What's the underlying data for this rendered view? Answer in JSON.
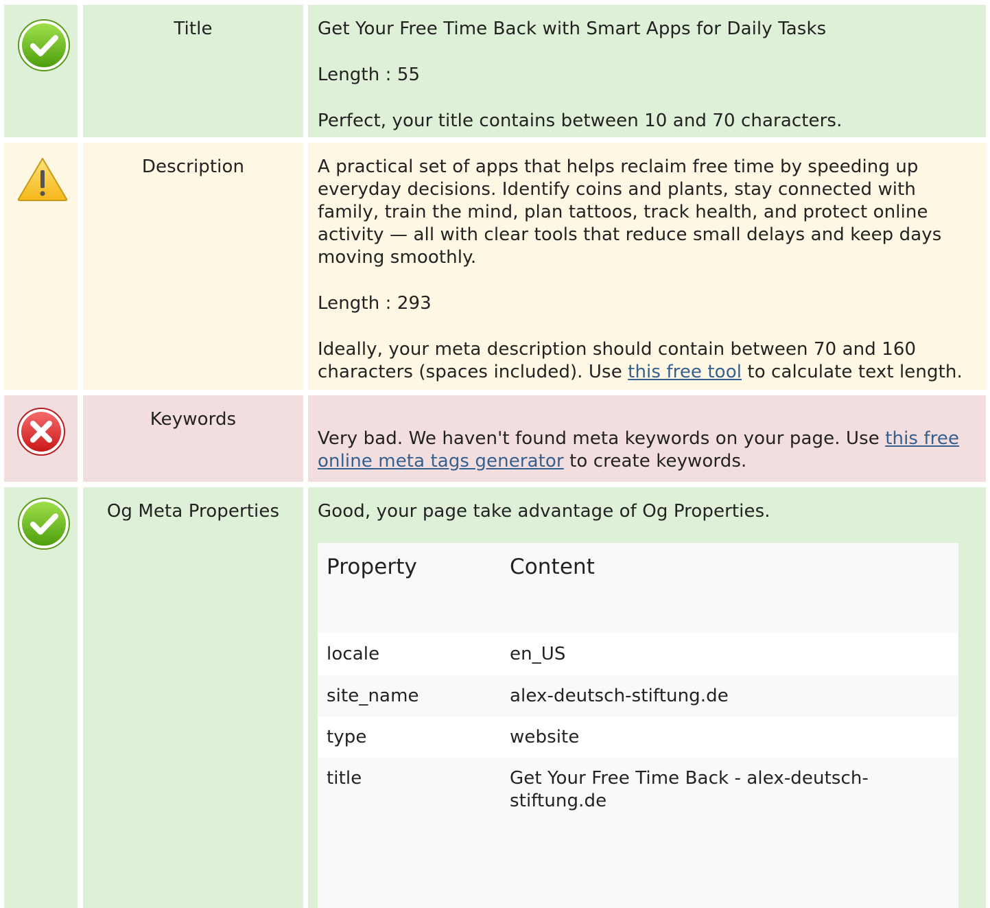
{
  "rows": [
    {
      "status": "good",
      "icon": "check-circle-icon",
      "label": "Title",
      "title_value": "Get Your Free Time Back with Smart Apps for Daily Tasks",
      "length_text": "Length : 55",
      "message": "Perfect, your title contains between 10 and 70 characters."
    },
    {
      "status": "warning",
      "icon": "warning-triangle-icon",
      "label": "Description",
      "description_value": "A practical set of apps that helps reclaim free time by speeding up everyday decisions. Identify coins and plants, stay connected with family, train the mind, plan tattoos, track health, and protect online activity — all with clear tools that reduce small delays and keep days moving smoothly.",
      "length_text": "Length : 293",
      "message_before": "Ideally, your meta description should contain between 70 and 160 characters (spaces included). Use ",
      "link_text": "this free tool",
      "message_after": " to calculate text length."
    },
    {
      "status": "bad",
      "icon": "error-x-circle-icon",
      "label": "Keywords",
      "message_before": "Very bad. We haven't found meta keywords on your page. Use ",
      "link_text": "this free online meta tags generator",
      "message_after": " to create keywords."
    },
    {
      "status": "good",
      "icon": "check-circle-icon",
      "label": "Og Meta Properties",
      "message": "Good, your page take advantage of Og Properties.",
      "table": {
        "headers": [
          "Property",
          "Content"
        ],
        "rows": [
          {
            "property": "locale",
            "content": "en_US"
          },
          {
            "property": "site_name",
            "content": "alex-deutsch-stiftung.de"
          },
          {
            "property": "type",
            "content": "website"
          },
          {
            "property": "title",
            "content": "Get Your Free Time Back - alex-deutsch-stiftung.de"
          }
        ]
      }
    }
  ],
  "colors": {
    "good_bg": "#dff0d8",
    "warning_bg": "#fdf7e3",
    "bad_bg": "#f2dede",
    "link": "#345f8f",
    "check_green": "#6cbf1f",
    "error_red": "#e02b2b",
    "warning_yellow": "#f7c531"
  }
}
